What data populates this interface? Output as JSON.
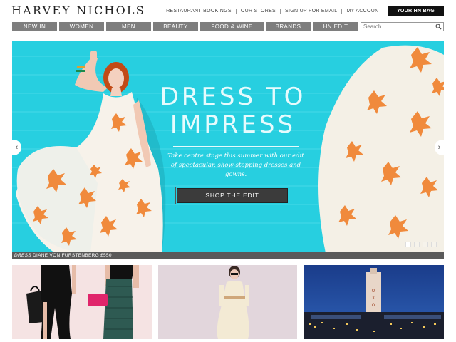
{
  "header": {
    "logo": "HARVEY NICHOLS",
    "links": [
      "RESTAURANT BOOKINGS",
      "OUR STORES",
      "SIGN UP FOR EMAIL",
      "MY ACCOUNT"
    ],
    "bag_label": "YOUR HN BAG"
  },
  "nav": {
    "items": [
      "NEW IN",
      "WOMEN",
      "MEN",
      "BEAUTY",
      "FOOD & WINE",
      "BRANDS",
      "HN EDIT"
    ],
    "search_placeholder": "Search"
  },
  "hero": {
    "headline_line1": "DRESS TO",
    "headline_line2": "IMPRESS",
    "subtext": "Take centre stage this summer with our edit of spectacular, show-stopping dresses and gowns.",
    "cta_label": "SHOP THE EDIT",
    "caption_label": "DRESS",
    "caption_text": "DIANE VON FURSTENBERG £550",
    "slides": 4,
    "active_slide": 1
  },
  "tiles": [
    {
      "name": "tile-women-fashion"
    },
    {
      "name": "tile-white-dress"
    },
    {
      "name": "tile-oxo-tower"
    }
  ],
  "colors": {
    "hero_bg": "#27cfe0",
    "nav_bg": "#7e7e7e",
    "bag_bg": "#111111",
    "print_orange": "#f08a3c"
  }
}
